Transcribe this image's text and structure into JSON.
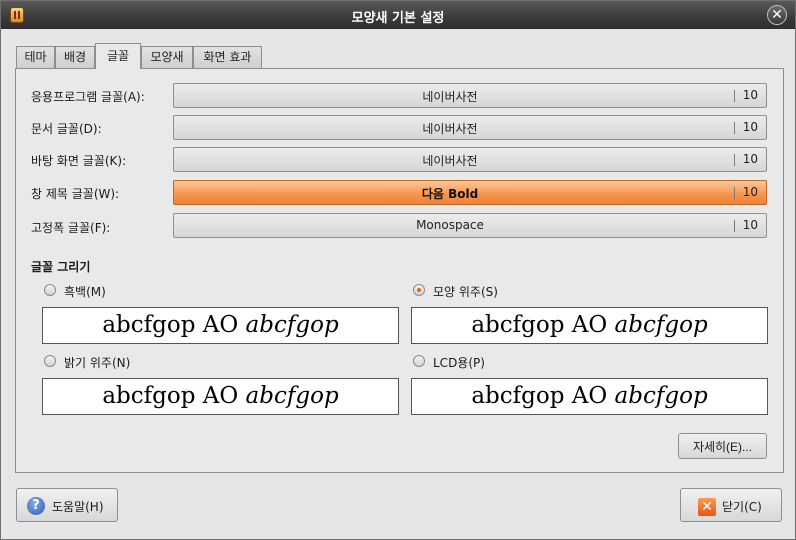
{
  "window": {
    "title": "모양새 기본 설정"
  },
  "tabs": [
    {
      "label": "테마"
    },
    {
      "label": "배경"
    },
    {
      "label": "글꼴"
    },
    {
      "label": "모양새"
    },
    {
      "label": "화면 효과"
    }
  ],
  "fonts": {
    "application": {
      "label": "응용프로그램 글꼴(A):",
      "name": "네이버사전",
      "size": "10"
    },
    "document": {
      "label": "문서 글꼴(D):",
      "name": "네이버사전",
      "size": "10"
    },
    "desktop": {
      "label": "바탕 화면 글꼴(K):",
      "name": "네이버사전",
      "size": "10"
    },
    "window_title": {
      "label": "창 제목 글꼴(W):",
      "name": "다음 Bold",
      "size": "10"
    },
    "fixed_width": {
      "label": "고정폭 글꼴(F):",
      "name": "Monospace",
      "size": "10"
    }
  },
  "rendering": {
    "title": "글꼴 그리기",
    "options": [
      {
        "label": "흑백(M)",
        "selected": false,
        "preview_normal": "abcfgop AO ",
        "preview_italic": "abcfgop"
      },
      {
        "label": "모양 위주(S)",
        "selected": true,
        "preview_normal": "abcfgop AO ",
        "preview_italic": "abcfgop"
      },
      {
        "label": "밝기 위주(N)",
        "selected": false,
        "preview_normal": "abcfgop AO ",
        "preview_italic": "abcfgop"
      },
      {
        "label": "LCD용(P)",
        "selected": false,
        "preview_normal": "abcfgop AO ",
        "preview_italic": "abcfgop"
      }
    ]
  },
  "details_button": {
    "label": "자세히(E)..."
  },
  "help_button": {
    "label": "도움말(H)",
    "icon": "help-icon"
  },
  "close_button": {
    "label": "닫기(C)",
    "icon": "close-icon"
  },
  "colors": {
    "accent": "#f28a3e",
    "titlebar": "#3c3c3c"
  }
}
